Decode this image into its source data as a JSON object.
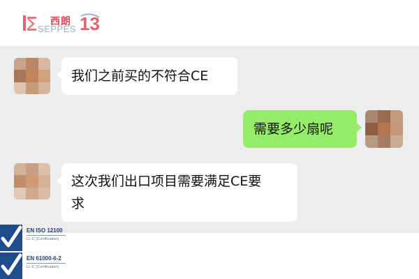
{
  "brand": {
    "logo_cn": "西朗",
    "logo_en": "SEPPES",
    "logo_number": "13",
    "colors": {
      "red": "#d94b57",
      "blue": "#9db1cf"
    }
  },
  "chat": {
    "background": "#ededed",
    "messages": [
      {
        "side": "left",
        "text": "我们之前买的不符合CE"
      },
      {
        "side": "right",
        "text": "需要多少扇呢"
      },
      {
        "side": "left",
        "lines": [
          "这次我们出口项目需要满足CE要",
          "求"
        ]
      }
    ],
    "bubble_colors": {
      "incoming": "#ffffff",
      "outgoing": "#95ec69"
    }
  },
  "certifications": [
    {
      "title": "EN ISO 12100",
      "subtitle": "LL-C (Certification)"
    },
    {
      "title": "EN 61000-6-2",
      "subtitle": "LL-C (Certification)"
    }
  ],
  "icons": {
    "avatar": "pixelated-avatar",
    "cert_badge": "checkmark-icon"
  }
}
